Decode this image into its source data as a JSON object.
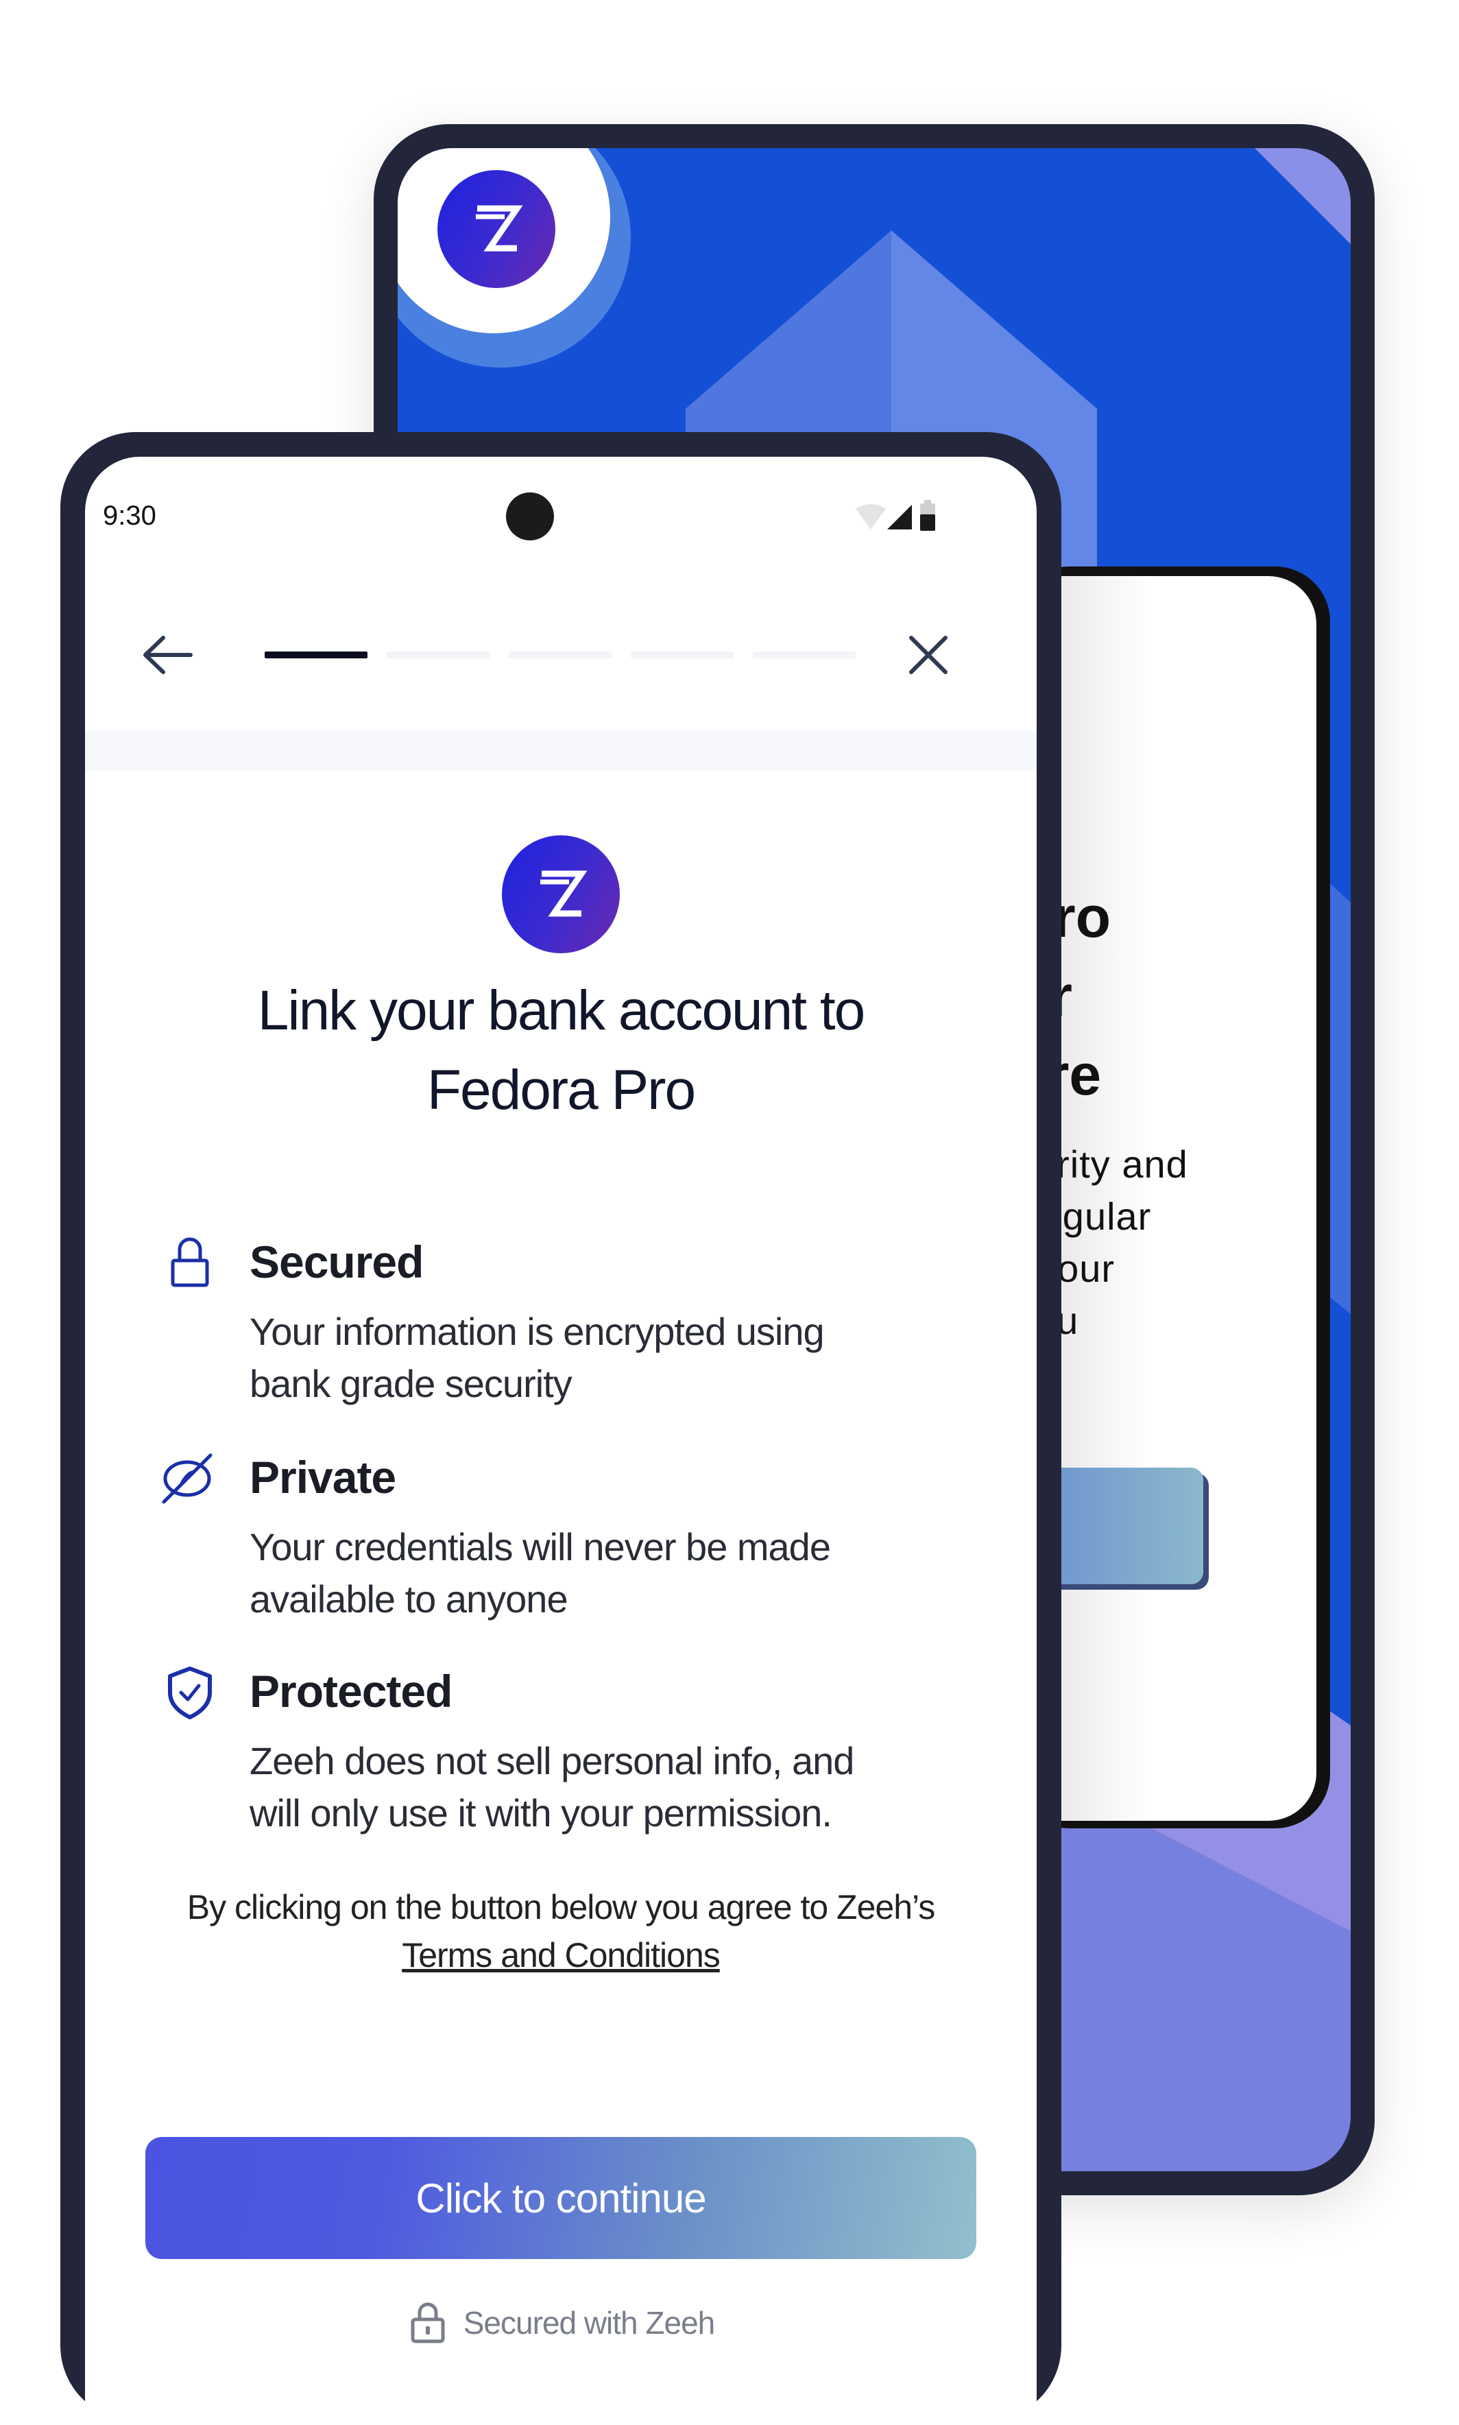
{
  "colors": {
    "brand_blue": "#1450d6",
    "logo_gradient_start": "#1d22e0",
    "logo_gradient_end": "#6a2ab0",
    "icon_blue": "#1a2fa8",
    "button_gradient_start": "#4b54e0",
    "button_gradient_end": "#92c0cc",
    "text_dark": "#11162a"
  },
  "back_phone": {
    "logo_icon": "zeeh-logo-icon",
    "title_fragments": [
      "Pro",
      "ur",
      "ere"
    ],
    "text_fragments": [
      "curity and",
      "regular",
      "t your",
      "you"
    ]
  },
  "status_bar": {
    "time": "9:30",
    "icons": [
      "wifi-icon",
      "signal-icon",
      "battery-icon"
    ]
  },
  "nav": {
    "back_icon": "arrow-left-icon",
    "close_icon": "close-icon",
    "steps_total": 5,
    "current_step": 1
  },
  "main": {
    "logo_icon": "zeeh-logo-icon",
    "headline_line1": "Link your bank account to",
    "headline_line2": "Fedora Pro",
    "features": [
      {
        "icon": "lock-icon",
        "title": "Secured",
        "desc_line1": "Your information is encrypted using",
        "desc_line2": "bank grade security"
      },
      {
        "icon": "eye-off-icon",
        "title": "Private",
        "desc_line1": "Your credentials will never be made",
        "desc_line2": "available to anyone"
      },
      {
        "icon": "shield-check-icon",
        "title": "Protected",
        "desc_line1": "Zeeh does not sell personal info, and",
        "desc_line2": "will only use it with your permission."
      }
    ],
    "agree_text": "By clicking on the button below you agree to Zeeh’s",
    "terms_link": "Terms and Conditions",
    "continue_label": "Click to continue",
    "secured_footer": "Secured with Zeeh"
  }
}
